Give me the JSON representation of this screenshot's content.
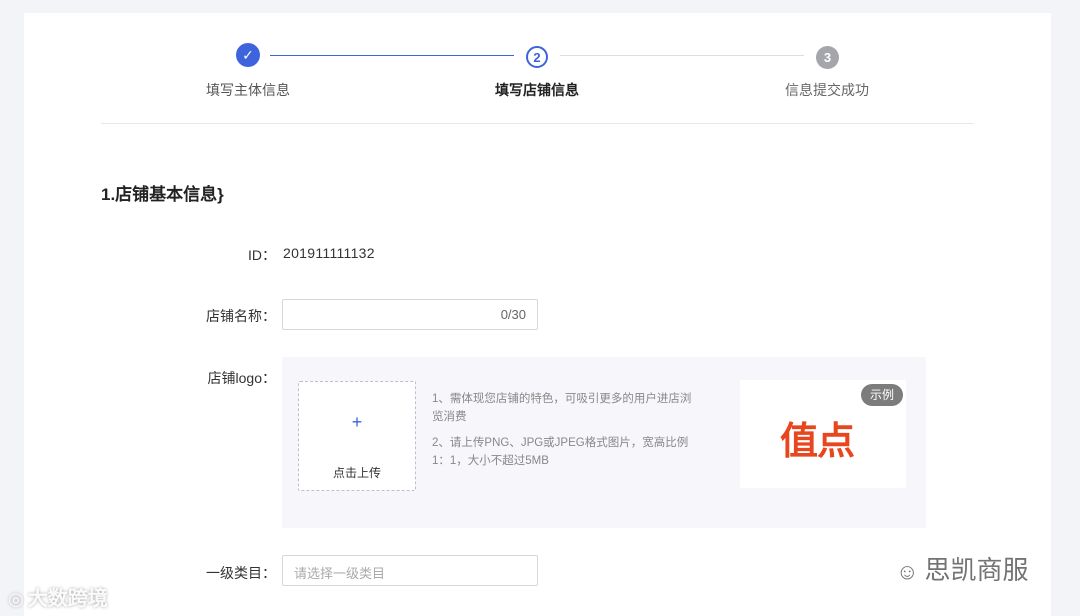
{
  "steps": [
    {
      "number": "✓",
      "label": "填写主体信息",
      "state": "done"
    },
    {
      "number": "2",
      "label": "填写店铺信息",
      "state": "active"
    },
    {
      "number": "3",
      "label": "信息提交成功",
      "state": "pending"
    }
  ],
  "section": {
    "title": "1.店铺基本信息}"
  },
  "form": {
    "id_label": "ID：",
    "id_value": "201911111132",
    "name_label": "店铺名称：",
    "name_counter": "0/30",
    "logo_label": "店铺logo：",
    "upload_plus": "+",
    "upload_text": "点击上传",
    "tips": [
      "1、需体现您店铺的特色，可吸引更多的用户进店浏览消费",
      "2、请上传PNG、JPG或JPEG格式图片，宽高比例1：1，大小不超过5MB"
    ],
    "example_badge": "示例",
    "example_logo_text": "值点",
    "category_label": "一级类目：",
    "category_placeholder": "请选择一级类目"
  },
  "watermarks": {
    "left": "大数跨境",
    "right": "思凯商服"
  },
  "colors": {
    "accent": "#3d63dd",
    "pending": "#a4a6ab",
    "logo_red": "#e8461e"
  }
}
